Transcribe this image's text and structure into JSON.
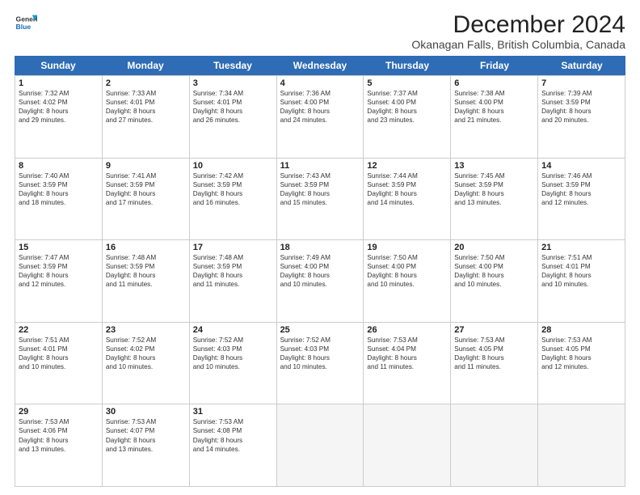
{
  "header": {
    "logo_line1": "General",
    "logo_line2": "Blue",
    "title": "December 2024",
    "subtitle": "Okanagan Falls, British Columbia, Canada"
  },
  "days_of_week": [
    "Sunday",
    "Monday",
    "Tuesday",
    "Wednesday",
    "Thursday",
    "Friday",
    "Saturday"
  ],
  "weeks": [
    [
      {
        "day": 1,
        "sunrise": "Sunrise: 7:32 AM",
        "sunset": "Sunset: 4:02 PM",
        "daylight": "Daylight: 8 hours and 29 minutes."
      },
      {
        "day": 2,
        "sunrise": "Sunrise: 7:33 AM",
        "sunset": "Sunset: 4:01 PM",
        "daylight": "Daylight: 8 hours and 27 minutes."
      },
      {
        "day": 3,
        "sunrise": "Sunrise: 7:34 AM",
        "sunset": "Sunset: 4:01 PM",
        "daylight": "Daylight: 8 hours and 26 minutes."
      },
      {
        "day": 4,
        "sunrise": "Sunrise: 7:36 AM",
        "sunset": "Sunset: 4:00 PM",
        "daylight": "Daylight: 8 hours and 24 minutes."
      },
      {
        "day": 5,
        "sunrise": "Sunrise: 7:37 AM",
        "sunset": "Sunset: 4:00 PM",
        "daylight": "Daylight: 8 hours and 23 minutes."
      },
      {
        "day": 6,
        "sunrise": "Sunrise: 7:38 AM",
        "sunset": "Sunset: 4:00 PM",
        "daylight": "Daylight: 8 hours and 21 minutes."
      },
      {
        "day": 7,
        "sunrise": "Sunrise: 7:39 AM",
        "sunset": "Sunset: 3:59 PM",
        "daylight": "Daylight: 8 hours and 20 minutes."
      }
    ],
    [
      {
        "day": 8,
        "sunrise": "Sunrise: 7:40 AM",
        "sunset": "Sunset: 3:59 PM",
        "daylight": "Daylight: 8 hours and 18 minutes."
      },
      {
        "day": 9,
        "sunrise": "Sunrise: 7:41 AM",
        "sunset": "Sunset: 3:59 PM",
        "daylight": "Daylight: 8 hours and 17 minutes."
      },
      {
        "day": 10,
        "sunrise": "Sunrise: 7:42 AM",
        "sunset": "Sunset: 3:59 PM",
        "daylight": "Daylight: 8 hours and 16 minutes."
      },
      {
        "day": 11,
        "sunrise": "Sunrise: 7:43 AM",
        "sunset": "Sunset: 3:59 PM",
        "daylight": "Daylight: 8 hours and 15 minutes."
      },
      {
        "day": 12,
        "sunrise": "Sunrise: 7:44 AM",
        "sunset": "Sunset: 3:59 PM",
        "daylight": "Daylight: 8 hours and 14 minutes."
      },
      {
        "day": 13,
        "sunrise": "Sunrise: 7:45 AM",
        "sunset": "Sunset: 3:59 PM",
        "daylight": "Daylight: 8 hours and 13 minutes."
      },
      {
        "day": 14,
        "sunrise": "Sunrise: 7:46 AM",
        "sunset": "Sunset: 3:59 PM",
        "daylight": "Daylight: 8 hours and 12 minutes."
      }
    ],
    [
      {
        "day": 15,
        "sunrise": "Sunrise: 7:47 AM",
        "sunset": "Sunset: 3:59 PM",
        "daylight": "Daylight: 8 hours and 12 minutes."
      },
      {
        "day": 16,
        "sunrise": "Sunrise: 7:48 AM",
        "sunset": "Sunset: 3:59 PM",
        "daylight": "Daylight: 8 hours and 11 minutes."
      },
      {
        "day": 17,
        "sunrise": "Sunrise: 7:48 AM",
        "sunset": "Sunset: 3:59 PM",
        "daylight": "Daylight: 8 hours and 11 minutes."
      },
      {
        "day": 18,
        "sunrise": "Sunrise: 7:49 AM",
        "sunset": "Sunset: 4:00 PM",
        "daylight": "Daylight: 8 hours and 10 minutes."
      },
      {
        "day": 19,
        "sunrise": "Sunrise: 7:50 AM",
        "sunset": "Sunset: 4:00 PM",
        "daylight": "Daylight: 8 hours and 10 minutes."
      },
      {
        "day": 20,
        "sunrise": "Sunrise: 7:50 AM",
        "sunset": "Sunset: 4:00 PM",
        "daylight": "Daylight: 8 hours and 10 minutes."
      },
      {
        "day": 21,
        "sunrise": "Sunrise: 7:51 AM",
        "sunset": "Sunset: 4:01 PM",
        "daylight": "Daylight: 8 hours and 10 minutes."
      }
    ],
    [
      {
        "day": 22,
        "sunrise": "Sunrise: 7:51 AM",
        "sunset": "Sunset: 4:01 PM",
        "daylight": "Daylight: 8 hours and 10 minutes."
      },
      {
        "day": 23,
        "sunrise": "Sunrise: 7:52 AM",
        "sunset": "Sunset: 4:02 PM",
        "daylight": "Daylight: 8 hours and 10 minutes."
      },
      {
        "day": 24,
        "sunrise": "Sunrise: 7:52 AM",
        "sunset": "Sunset: 4:03 PM",
        "daylight": "Daylight: 8 hours and 10 minutes."
      },
      {
        "day": 25,
        "sunrise": "Sunrise: 7:52 AM",
        "sunset": "Sunset: 4:03 PM",
        "daylight": "Daylight: 8 hours and 10 minutes."
      },
      {
        "day": 26,
        "sunrise": "Sunrise: 7:53 AM",
        "sunset": "Sunset: 4:04 PM",
        "daylight": "Daylight: 8 hours and 11 minutes."
      },
      {
        "day": 27,
        "sunrise": "Sunrise: 7:53 AM",
        "sunset": "Sunset: 4:05 PM",
        "daylight": "Daylight: 8 hours and 11 minutes."
      },
      {
        "day": 28,
        "sunrise": "Sunrise: 7:53 AM",
        "sunset": "Sunset: 4:05 PM",
        "daylight": "Daylight: 8 hours and 12 minutes."
      }
    ],
    [
      {
        "day": 29,
        "sunrise": "Sunrise: 7:53 AM",
        "sunset": "Sunset: 4:06 PM",
        "daylight": "Daylight: 8 hours and 13 minutes."
      },
      {
        "day": 30,
        "sunrise": "Sunrise: 7:53 AM",
        "sunset": "Sunset: 4:07 PM",
        "daylight": "Daylight: 8 hours and 13 minutes."
      },
      {
        "day": 31,
        "sunrise": "Sunrise: 7:53 AM",
        "sunset": "Sunset: 4:08 PM",
        "daylight": "Daylight: 8 hours and 14 minutes."
      },
      null,
      null,
      null,
      null
    ]
  ]
}
